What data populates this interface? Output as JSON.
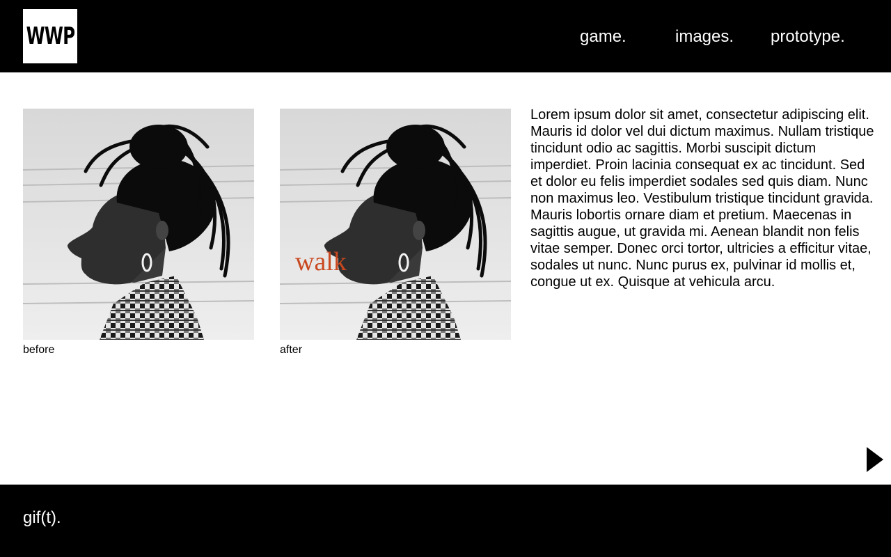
{
  "header": {
    "logo_text": "WWP",
    "nav": [
      {
        "label": "game."
      },
      {
        "label": "images."
      },
      {
        "label": "prototype."
      }
    ]
  },
  "figures": [
    {
      "caption": "before"
    },
    {
      "caption": "after",
      "overlay_text": "walk",
      "overlay_color": "#c9481f"
    }
  ],
  "body_text": "Lorem ipsum dolor sit amet, consectetur adipiscing elit. Mauris id dolor vel dui dictum maximus. Nullam tristique tincidunt odio ac sagittis. Morbi suscipit dictum imperdiet. Proin lacinia consequat ex ac tincidunt. Sed et dolor eu felis imperdiet sodales sed quis diam. Nunc non maximus leo. Vestibulum tristique tincidunt gravida. Mauris lobortis ornare diam et pretium. Maecenas in sagittis augue, ut gravida mi. Aenean blandit non felis vitae semper. Donec orci tortor, ultricies a efficitur vitae, sodales ut nunc. Nunc purus ex, pulvinar id mollis et, congue ut ex. Quisque at vehicula arcu.",
  "footer": {
    "label": "gif(t)."
  },
  "icons": {
    "next": "play-triangle-icon"
  },
  "colors": {
    "header_bg": "#000000",
    "footer_bg": "#000000",
    "accent": "#c9481f"
  }
}
